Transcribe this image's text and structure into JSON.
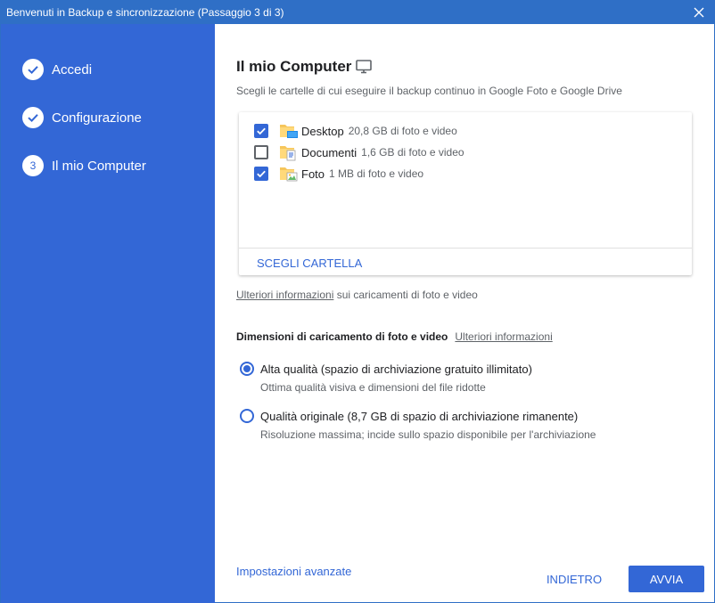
{
  "window": {
    "title": "Benvenuti in Backup e sincronizzazione (Passaggio 3 di 3)",
    "close_icon": "close-icon"
  },
  "sidebar": {
    "steps": [
      {
        "label": "Accedi",
        "state": "done",
        "icon": "check-icon"
      },
      {
        "label": "Configurazione",
        "state": "done",
        "icon": "check-icon"
      },
      {
        "label": "Il mio Computer",
        "state": "current",
        "number": "3"
      }
    ]
  },
  "main": {
    "title": "Il mio Computer",
    "title_icon": "monitor-icon",
    "subtitle": "Scegli le cartelle di cui eseguire il backup continuo in Google Foto e Google Drive",
    "folders": [
      {
        "name": "Desktop",
        "size": "20,8 GB di foto e video",
        "checked": true,
        "icon": "desktop-folder-icon"
      },
      {
        "name": "Documenti",
        "size": "1,6 GB di foto e video",
        "checked": false,
        "icon": "documents-folder-icon"
      },
      {
        "name": "Foto",
        "size": "1 MB di foto e video",
        "checked": true,
        "icon": "pictures-folder-icon"
      }
    ],
    "choose_folder_label": "SCEGLI CARTELLA",
    "info": {
      "link": "Ulteriori informazioni",
      "text": " sui caricamenti di foto e video"
    },
    "upload_size": {
      "heading": "Dimensioni di caricamento di foto e video",
      "link": "Ulteriori informazioni",
      "options": [
        {
          "label": "Alta qualità (spazio di archiviazione gratuito illimitato)",
          "description": "Ottima qualità visiva e dimensioni del file ridotte",
          "selected": true
        },
        {
          "label": "Qualità originale (8,7 GB di spazio di archiviazione rimanente)",
          "description": "Risoluzione massima; incide sullo spazio disponibile per l'archiviazione",
          "selected": false
        }
      ]
    },
    "advanced_settings_label": "Impostazioni avanzate",
    "back_label": "INDIETRO",
    "start_label": "AVVIA"
  },
  "colors": {
    "accent": "#3367d6",
    "titlebar": "#2f6fc6",
    "text": "#202124",
    "secondary_text": "#5f6368"
  }
}
